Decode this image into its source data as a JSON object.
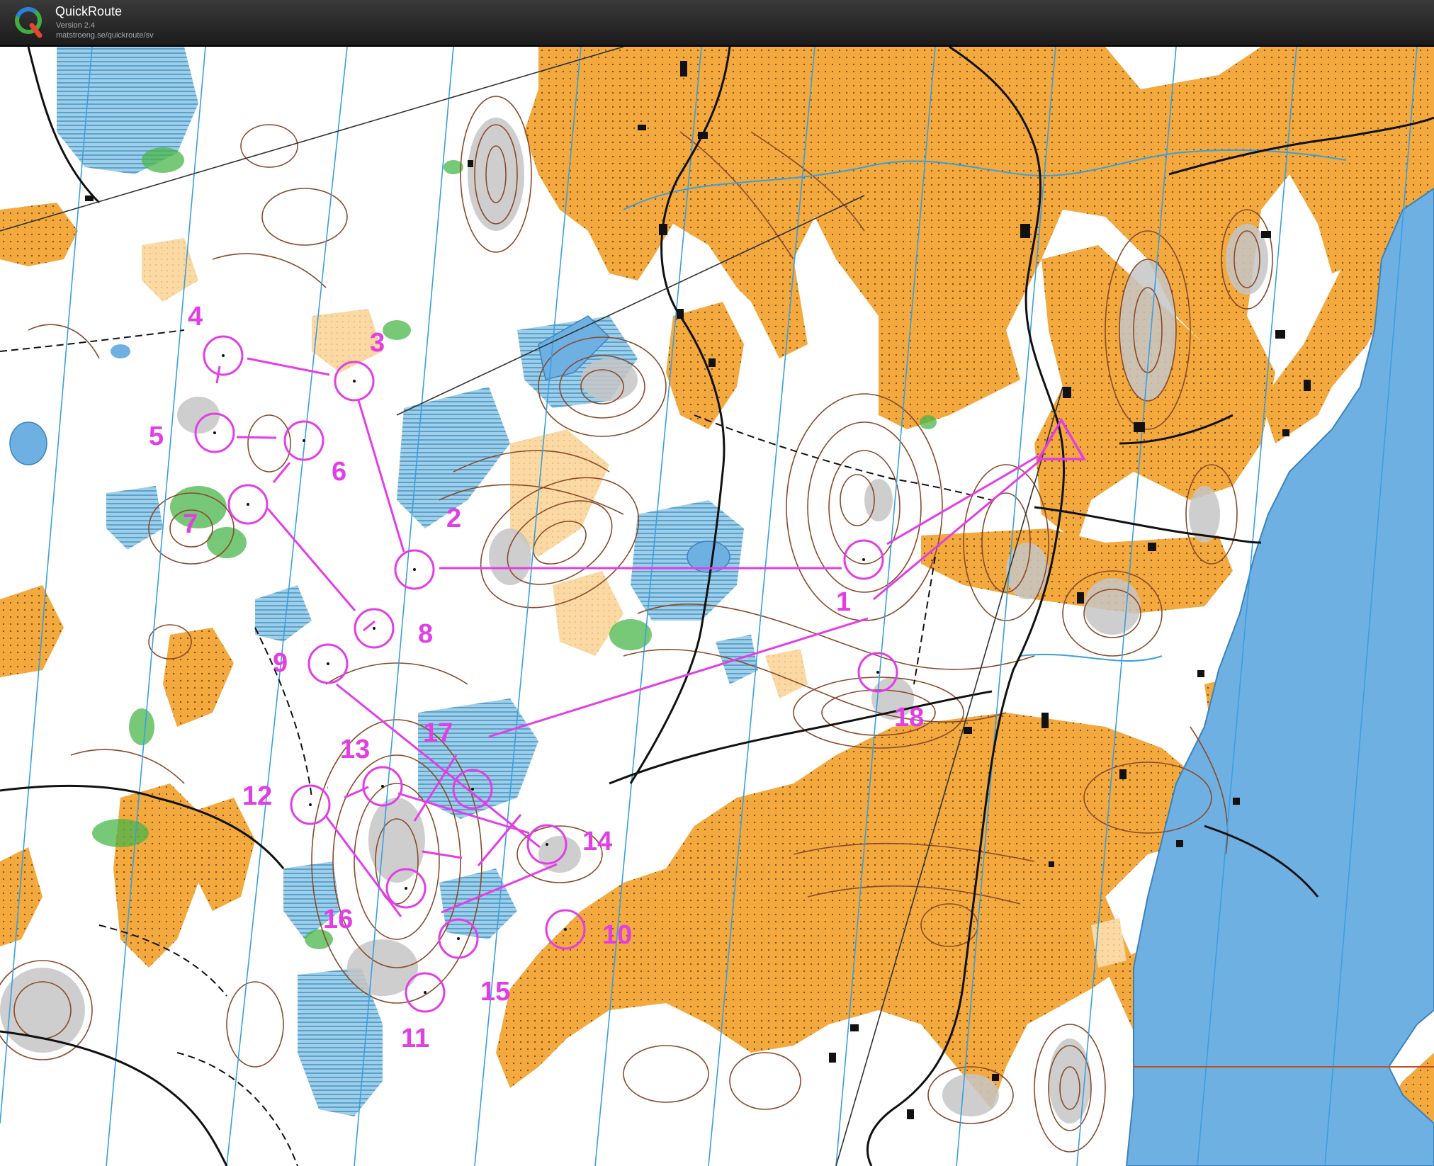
{
  "app": {
    "title": "QuickRoute",
    "version": "Version 2.4",
    "url": "matstroeng.se/quickroute/sv",
    "logo_icon": "quickroute-q-logo"
  },
  "map": {
    "kind": "orienteering map",
    "colors": {
      "course": "#e23ee6",
      "open_land": "#f2a73b",
      "water": "#6fb0e2",
      "marsh": "#4f9fc8",
      "contour": "#8a4a2a",
      "vegetation_green": "#49b54a",
      "rock_grey": "#bdbdbd",
      "road_black": "#111111",
      "magnetic_north_lines": "#3a9fe0"
    },
    "course": {
      "start_symbol": "start-triangle-icon",
      "control_labels": [
        "1",
        "2",
        "3",
        "4",
        "5",
        "6",
        "7",
        "8",
        "9",
        "10",
        "11",
        "12",
        "13",
        "14",
        "15",
        "16",
        "17",
        "18"
      ]
    }
  }
}
